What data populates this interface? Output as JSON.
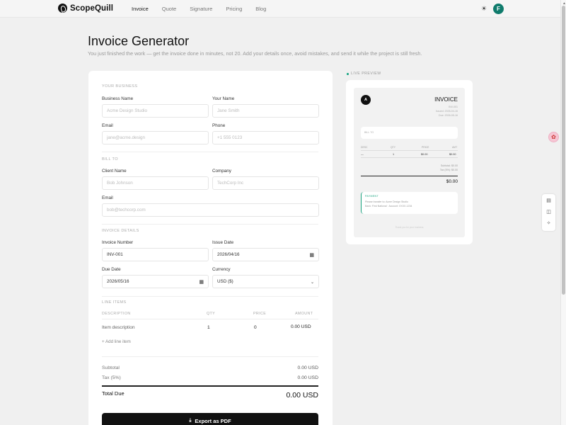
{
  "nav": {
    "brand": "ScopeQuill",
    "links": [
      "Invoice",
      "Quote",
      "Signature",
      "Pricing",
      "Blog"
    ],
    "avatar_initial": "F"
  },
  "header": {
    "title": "Invoice Generator",
    "subtitle": "You just finished the work — get the invoice done in minutes, not 20. Add your details once, avoid mistakes, and send it while the project is still fresh."
  },
  "form": {
    "your_business": {
      "title": "YOUR BUSINESS",
      "business_name_label": "Business Name",
      "business_name_placeholder": "Acme Design Studio",
      "your_name_label": "Your Name",
      "your_name_placeholder": "Jane Smith",
      "email_label": "Email",
      "email_placeholder": "jane@acme.design",
      "phone_label": "Phone",
      "phone_placeholder": "+1 555 0123"
    },
    "bill_to": {
      "title": "BILL TO",
      "client_name_label": "Client Name",
      "client_name_placeholder": "Bob Johnson",
      "company_label": "Company",
      "company_placeholder": "TechCorp Inc",
      "email_label": "Email",
      "email_placeholder": "bob@techcorp.com"
    },
    "invoice_details": {
      "title": "INVOICE DETAILS",
      "invoice_number_label": "Invoice Number",
      "invoice_number_value": "INV-001",
      "issue_date_label": "Issue Date",
      "issue_date_value": "2026/04/16",
      "due_date_label": "Due Date",
      "due_date_value": "2026/05/16",
      "currency_label": "Currency",
      "currency_value": "USD ($)"
    },
    "line_items": {
      "title": "LINE ITEMS",
      "columns": [
        "DESCRIPTION",
        "QTY",
        "PRICE",
        "AMOUNT"
      ],
      "rows": [
        {
          "description": "Item description",
          "qty": "1",
          "price": "0",
          "amount": "0.00 USD"
        }
      ],
      "add_label": "Add line item"
    },
    "summary": {
      "subtotal_label": "Subtotal",
      "subtotal_value": "0.00 USD",
      "tax_label": "Tax (5%)",
      "tax_value": "0.00 USD",
      "total_label": "Total Due",
      "total_value": "0.00 USD"
    },
    "export_label": "Export as PDF"
  },
  "preview": {
    "label": "LIVE PREVIEW",
    "logo_initial": "A",
    "doc_title": "INVOICE",
    "meta": [
      "INV-001",
      "Issued: 2026-04-16",
      "Due: 2026-05-16"
    ],
    "bill_to": "BILL TO",
    "columns": [
      "DESC",
      "QTY",
      "PRICE",
      "AMT"
    ],
    "row": [
      "—",
      "1",
      "$0.00",
      "$0.00"
    ],
    "subtotal": "Subtotal: $0.00",
    "tax": "Tax (5%): $0.00",
    "total": "$0.00",
    "payment_title": "PAYMENT",
    "payment_lines": [
      "Please transfer to: Acme Design Studio",
      "Bank: First National · Account: XXXX-1234"
    ],
    "footer": "Thank you for your business"
  },
  "colors": {
    "accent": "#0f7b6c",
    "payment": "#1aa37f",
    "button": "#111111"
  }
}
